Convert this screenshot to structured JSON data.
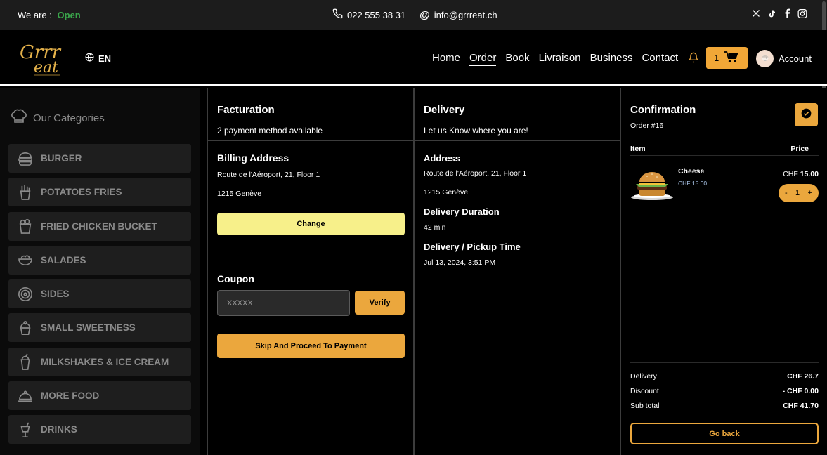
{
  "topbar": {
    "status_label": "We are :",
    "status_value": "Open",
    "phone": "022 555 38 31",
    "email": "info@grrreat.ch",
    "socials": [
      "x-icon",
      "tiktok-icon",
      "facebook-icon",
      "instagram-icon"
    ]
  },
  "header": {
    "language": "EN",
    "nav": [
      "Home",
      "Order",
      "Book",
      "Livraison",
      "Business",
      "Contact"
    ],
    "active_nav": "Order",
    "cart_count": "1",
    "account_label": "Account"
  },
  "sidebar": {
    "title": "Our Categories",
    "items": [
      {
        "label": "BURGER",
        "icon": "burger-icon"
      },
      {
        "label": "POTATOES FRIES",
        "icon": "fries-icon"
      },
      {
        "label": "FRIED CHICKEN BUCKET",
        "icon": "bucket-icon"
      },
      {
        "label": "SALADES",
        "icon": "salad-icon"
      },
      {
        "label": "SIDES",
        "icon": "sides-icon"
      },
      {
        "label": "SMALL SWEETNESS",
        "icon": "cupcake-icon"
      },
      {
        "label": "MILKSHAKES & ICE CREAM",
        "icon": "milkshake-icon"
      },
      {
        "label": "MORE FOOD",
        "icon": "cloche-icon"
      },
      {
        "label": "DRINKS",
        "icon": "drink-icon"
      }
    ]
  },
  "facturation": {
    "title": "Facturation",
    "subtitle": "2 payment method available",
    "billing_title": "Billing Address",
    "address_line1": "Route de l'Aéroport, 21, Floor 1",
    "address_line2": "1215 Genève",
    "change_label": "Change",
    "coupon_title": "Coupon",
    "coupon_placeholder": "XXXXX",
    "verify_label": "Verify",
    "proceed_label": "Skip And Proceed To Payment"
  },
  "delivery": {
    "title": "Delivery",
    "subtitle": "Let us Know where you are!",
    "address_title": "Address",
    "address_line1": "Route de l'Aéroport, 21, Floor 1",
    "address_line2": "1215 Genève",
    "duration_title": "Delivery Duration",
    "duration_value": "42 min",
    "time_title": "Delivery / Pickup Time",
    "time_value": "Jul 13, 2024, 3:51 PM"
  },
  "confirmation": {
    "title": "Confirmation",
    "order_number": "Order #16",
    "col_item": "Item",
    "col_price": "Price",
    "item_name": "Cheese",
    "item_unit_price": "CHF 15.00",
    "item_currency": "CHF",
    "item_total": "15.00",
    "quantity": "1",
    "minus": "-",
    "plus": "+",
    "delivery_label": "Delivery",
    "delivery_value": "CHF 26.7",
    "discount_label": "Discount",
    "discount_value": "- CHF 0.00",
    "subtotal_label": "Sub total",
    "subtotal_value": "CHF 41.70",
    "goback_label": "Go back"
  }
}
